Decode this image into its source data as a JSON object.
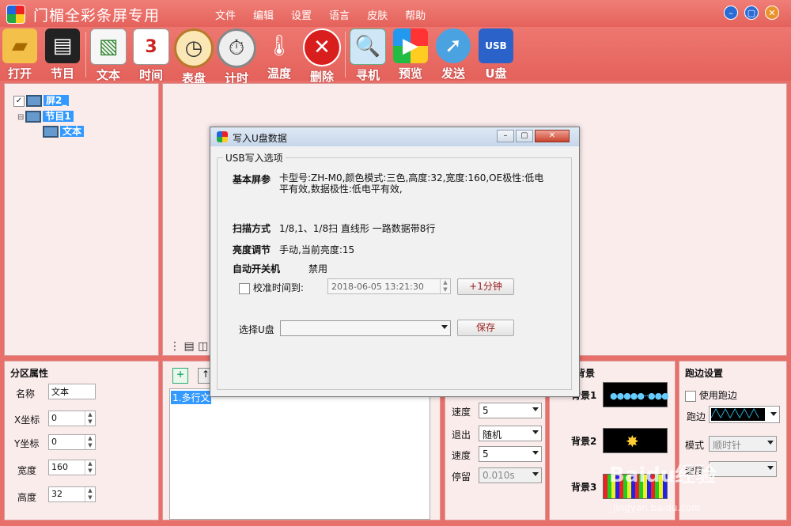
{
  "app": {
    "title": "门楣全彩条屏专用"
  },
  "menu": [
    "文件",
    "编辑",
    "设置",
    "语言",
    "皮肤",
    "帮助"
  ],
  "toolbar": [
    {
      "label": "打开",
      "icon": "folder-icon"
    },
    {
      "label": "节目",
      "icon": "clapperboard-icon"
    },
    {
      "label": "文本",
      "icon": "document-icon"
    },
    {
      "label": "时间",
      "icon": "calendar-icon"
    },
    {
      "label": "表盘",
      "icon": "clock-icon"
    },
    {
      "label": "计时",
      "icon": "stopwatch-icon"
    },
    {
      "label": "温度",
      "icon": "thermometer-icon"
    },
    {
      "label": "删除",
      "icon": "delete-icon"
    },
    {
      "label": "寻机",
      "icon": "search-monitor-icon"
    },
    {
      "label": "预览",
      "icon": "play-icon"
    },
    {
      "label": "发送",
      "icon": "send-icon"
    },
    {
      "label": "U盘",
      "icon": "usb-icon"
    }
  ],
  "tree": {
    "screen": "屏2_",
    "program": "节目1",
    "text": "文本"
  },
  "partition": {
    "title": "分区属性",
    "name_label": "名称",
    "name_value": "文本",
    "x_label": "X坐标",
    "x_value": "0",
    "y_label": "Y坐标",
    "y_value": "0",
    "w_label": "宽度",
    "w_value": "160",
    "h_label": "高度",
    "h_value": "32"
  },
  "list": {
    "item1": "1.多行文"
  },
  "effects": {
    "speed1_label": "速度",
    "speed1_value": "5",
    "exit_label": "退出",
    "exit_value": "随机",
    "speed2_label": "速度",
    "speed2_value": "5",
    "stay_label": "停留",
    "stay_value": "0.010s"
  },
  "background": {
    "title": "背景",
    "bg1": "背景1",
    "bg2": "背景2",
    "bg3": "背景3"
  },
  "border": {
    "title": "跑边设置",
    "use_label": "使用跑边",
    "border_label": "跑边",
    "mode_label": "模式",
    "mode_value": "顺时针",
    "speed_label": "速度"
  },
  "dialog": {
    "title": "写入U盘数据",
    "group_title": "USB写入选项",
    "basic_label": "基本屏参",
    "basic_value": "卡型号:ZH-M0,颜色模式:三色,高度:32,宽度:160,OE极性:低电平有效,数据极性:低电平有效,",
    "scan_label": "扫描方式",
    "scan_value": "1/8,1、1/8扫 直线形 一路数据带8行",
    "bright_label": "亮度调节",
    "bright_value": "手动,当前亮度:15",
    "power_label": "自动开关机",
    "power_value": "禁用",
    "calib_label": "校准时间到:",
    "calib_value": "2018-06-05   13:21:30",
    "plus_btn": "+1分钟",
    "usb_label": "选择U盘",
    "save_btn": "保存"
  },
  "watermark": {
    "text": "Baidu经验",
    "url": "jingyan.baidu.com"
  }
}
